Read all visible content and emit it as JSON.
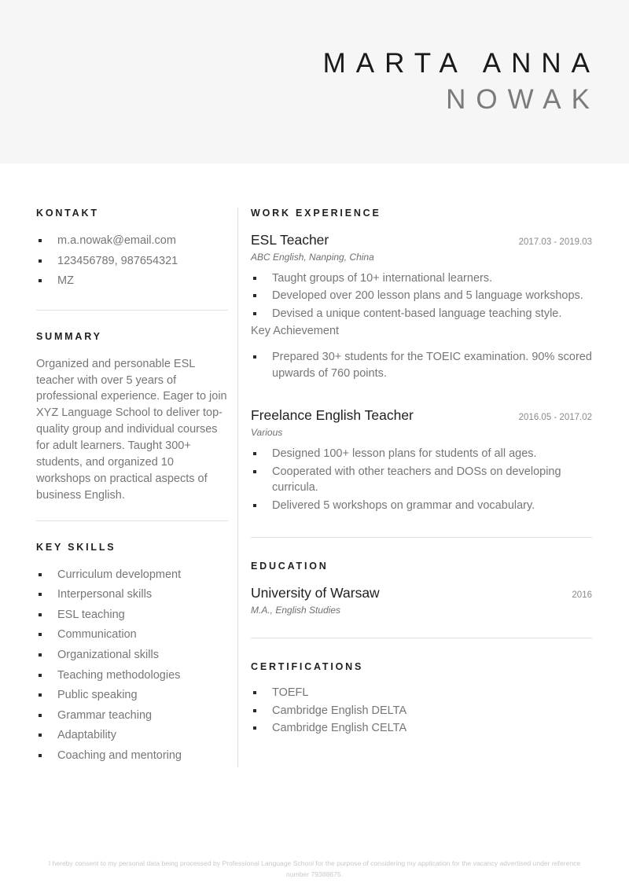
{
  "header": {
    "first_name": "MARTA ANNA",
    "last_name": "NOWAK",
    "background_color": "#f6f6f6"
  },
  "sidebar": {
    "contact": {
      "title": "KONTAKT",
      "items": [
        "m.a.nowak@email.com",
        "123456789, 987654321",
        "MZ"
      ]
    },
    "summary": {
      "title": "SUMMARY",
      "text": "Organized and personable ESL teacher with over 5 years of professional experience. Eager to join XYZ Language School to deliver top-quality group and individual courses for adult learners. Taught 300+ students, and organized 10 workshops on practical aspects of business English."
    },
    "skills": {
      "title": "KEY SKILLS",
      "items": [
        "Curriculum development",
        "Interpersonal skills",
        "ESL teaching",
        "Communication",
        "Organizational skills",
        "Teaching methodologies",
        "Public speaking",
        "Grammar teaching",
        "Adaptability",
        "Coaching and mentoring"
      ]
    }
  },
  "main": {
    "work": {
      "title": "WORK EXPERIENCE",
      "jobs": [
        {
          "title": "ESL Teacher",
          "date": "2017.03 - 2019.03",
          "subtitle": "ABC English, Nanping, China",
          "bullets": [
            "Taught groups of 10+ international learners.",
            "Developed over 200 lesson plans and 5 language workshops.",
            "Devised a unique content-based language teaching style."
          ],
          "achievement_label": "Key Achievement",
          "achievement_bullets": [
            "Prepared 30+ students for the TOEIC examination. 90% scored upwards of 760 points."
          ]
        },
        {
          "title": "Freelance English Teacher",
          "date": "2016.05 - 2017.02",
          "subtitle": "Various",
          "bullets": [
            "Designed 100+ lesson plans for students of all ages.",
            "Cooperated with other teachers and DOSs on developing curricula.",
            "Delivered 5 workshops on grammar and vocabulary."
          ]
        }
      ]
    },
    "education": {
      "title": "EDUCATION",
      "entries": [
        {
          "title": "University of Warsaw",
          "date": "2016",
          "subtitle": "M.A., English Studies"
        }
      ]
    },
    "certifications": {
      "title": "CERTIFICATIONS",
      "items": [
        "TOEFL",
        "Cambridge English DELTA",
        "Cambridge English CELTA"
      ]
    }
  },
  "footer": {
    "consent": "I hereby consent to my personal data being processed by Professional Language School for the purpose of considering my application for the vacancy advertised under reference number 79388675."
  }
}
